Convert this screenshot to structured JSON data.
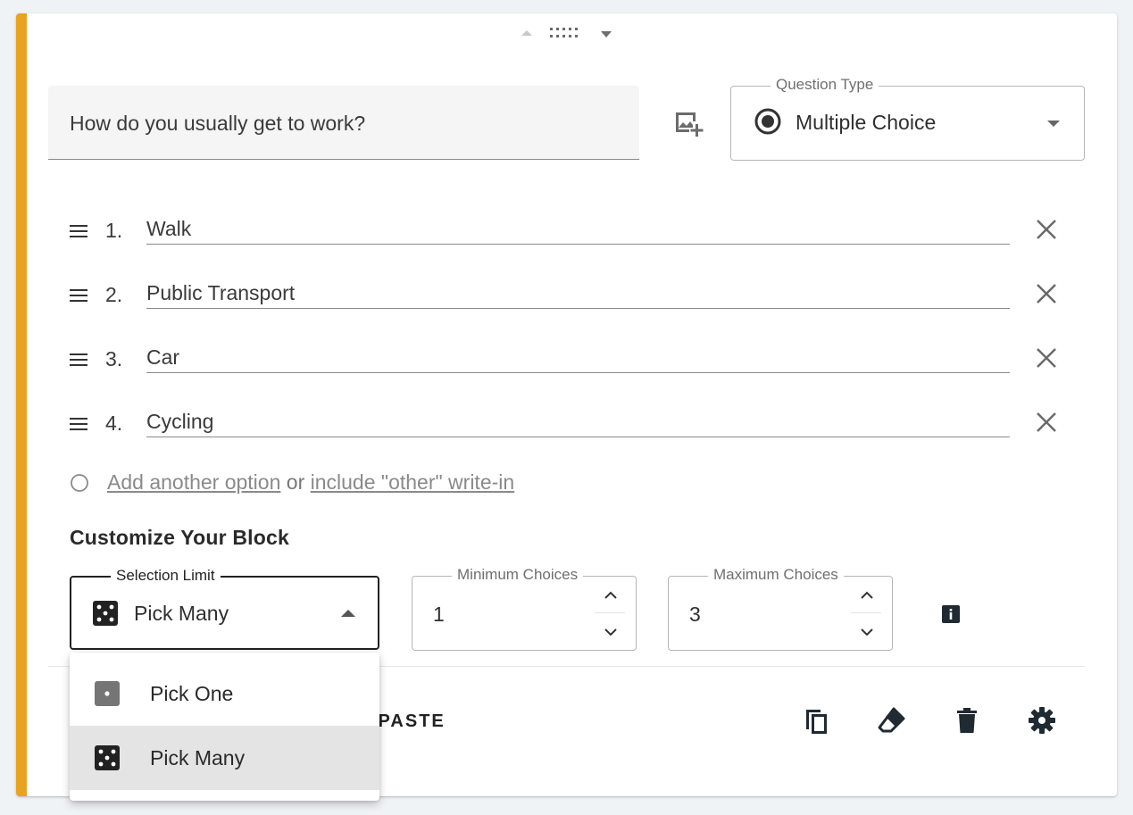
{
  "question": {
    "text": "How do you usually get to work?",
    "type_label": "Question Type",
    "type_value": "Multiple Choice"
  },
  "options": [
    {
      "number": "1.",
      "text": "Walk"
    },
    {
      "number": "2.",
      "text": "Public Transport"
    },
    {
      "number": "3.",
      "text": "Car"
    },
    {
      "number": "4.",
      "text": "Cycling"
    }
  ],
  "add_option": {
    "link1": "Add another option",
    "or": "or",
    "link2": "include \"other\" write-in"
  },
  "customize": {
    "title": "Customize Your Block",
    "selection_limit_label": "Selection Limit",
    "selection_limit_value": "Pick Many",
    "min_label": "Minimum Choices",
    "min_value": "1",
    "max_label": "Maximum Choices",
    "max_value": "3"
  },
  "footer": {
    "paste_partial": "/PASTE"
  },
  "menu": {
    "items": [
      {
        "label": "Pick One",
        "icon": "die-one-icon",
        "selected": false
      },
      {
        "label": "Pick Many",
        "icon": "die-five-icon",
        "selected": true
      }
    ]
  },
  "colors": {
    "accent": "#e8a320"
  }
}
